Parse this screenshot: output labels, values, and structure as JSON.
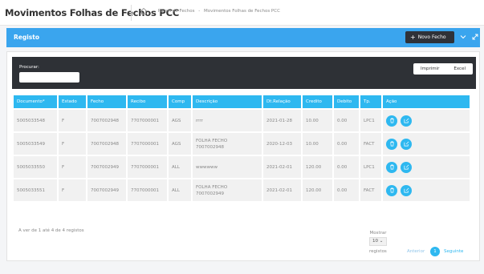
{
  "header": {
    "title": "Movimentos Folhas de Fechos PCC",
    "breadcrumb": [
      "Painel de Fechos",
      "Movimentos Folhas de Fechos PCC"
    ],
    "breadcrumb_sep": "-"
  },
  "registo": {
    "title": "Registo",
    "novo_label": "Novo Fecho"
  },
  "toolbar": {
    "search_label": "Procurar:",
    "search_value": "",
    "imprimir_label": "Imprimir",
    "excel_label": "Excel"
  },
  "table": {
    "columns": [
      "Documento*",
      "Estado",
      "Fecho",
      "Recibo",
      "Comp",
      "Descrição",
      "Dt.Relação",
      "Credito",
      "Debito",
      "Tp.",
      "Ação"
    ],
    "rows": [
      {
        "documento": "5005033548",
        "estado": "F",
        "fecho": "7007002948",
        "recibo": "7707000001",
        "comp": "AGS",
        "descricao_1": "rrrr",
        "descricao_2": "",
        "dt_relacao": "2021-01-28",
        "credito": "10.00",
        "debito": "0.00",
        "tp": "LPC1"
      },
      {
        "documento": "5005033549",
        "estado": "F",
        "fecho": "7007002948",
        "recibo": "7707000001",
        "comp": "AGS",
        "descricao_1": "FOLHA FECHO",
        "descricao_2": "7007002948",
        "dt_relacao": "2020-12-03",
        "credito": "10.00",
        "debito": "0.00",
        "tp": "FACT"
      },
      {
        "documento": "5005033550",
        "estado": "F",
        "fecho": "7007002949",
        "recibo": "7707000001",
        "comp": "ALL",
        "descricao_1": "wwwwww",
        "descricao_2": "",
        "dt_relacao": "2021-02-01",
        "credito": "120.00",
        "debito": "0.00",
        "tp": "LPC1"
      },
      {
        "documento": "5005033551",
        "estado": "F",
        "fecho": "7007002949",
        "recibo": "7707000001",
        "comp": "ALL",
        "descricao_1": "FOLHA FECHO",
        "descricao_2": "7007002949",
        "dt_relacao": "2021-02-01",
        "credito": "120.00",
        "debito": "0.00",
        "tp": "FACT"
      }
    ]
  },
  "footer": {
    "info": "A ver de 1 até 4 de 4 registos",
    "mostrar_label": "Mostrar",
    "mostrar_value": "10",
    "registos_label": "registos",
    "prev_label": "Anterior",
    "current_page": "1",
    "next_label": "Seguinte"
  },
  "colors": {
    "accent": "#2eb8f0",
    "bar": "#3aa5ee",
    "dark": "#2e3136"
  },
  "icons": {
    "home": "home-icon",
    "chevron": "chevron-down-icon",
    "expand": "expand-icon",
    "delete": "trash-icon",
    "edit": "edit-icon"
  }
}
